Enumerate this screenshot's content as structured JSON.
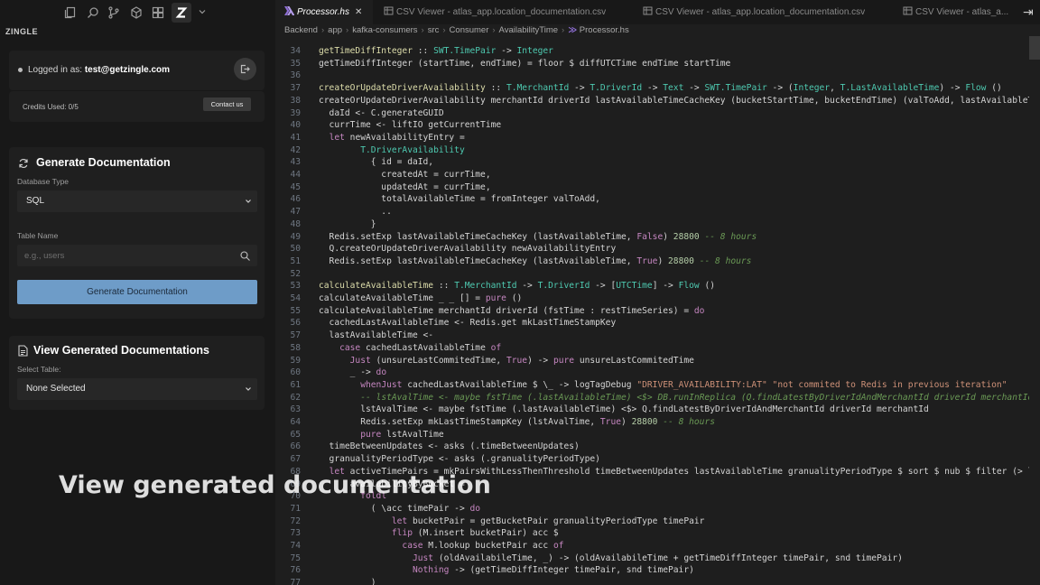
{
  "brand": "ZINGLE",
  "login": {
    "prefix": "Logged in as:",
    "email": "test@getzingle.com"
  },
  "credits": {
    "text": "Credits Used: 0/5",
    "contact_label": "Contact us"
  },
  "generate": {
    "title": "Generate Documentation",
    "db_type_label": "Database Type",
    "db_type_value": "SQL",
    "table_name_label": "Table Name",
    "table_name_placeholder": "e.g., users",
    "button_label": "Generate Documentation"
  },
  "view": {
    "title": "View Generated Documentations",
    "select_label": "Select Table:",
    "select_value": "None Selected"
  },
  "tabs": [
    {
      "label": "Processor.hs",
      "active": true
    },
    {
      "label": "CSV Viewer - atlas_app.location_documentation.csv"
    },
    {
      "label": "CSV Viewer - atlas_app.location_documentation.csv"
    },
    {
      "label": "CSV Viewer - atlas_a..."
    }
  ],
  "breadcrumb": [
    "Backend",
    "app",
    "kafka-consumers",
    "src",
    "Consumer",
    "AvailabilityTime",
    "Processor.hs"
  ],
  "code_lines": [
    {
      "n": "34",
      "t": "getTimeDiffInteger :: SWT.TimePair -> Integer"
    },
    {
      "n": "35",
      "t": "getTimeDiffInteger (startTime, endTime) = floor $ diffUTCTime endTime startTime"
    },
    {
      "n": "36",
      "t": ""
    },
    {
      "n": "37",
      "t": "createOrUpdateDriverAvailability :: T.MerchantId -> T.DriverId -> Text -> SWT.TimePair -> (Integer, T.LastAvailableTime) -> Flow ()"
    },
    {
      "n": "38",
      "t": "createOrUpdateDriverAvailability merchantId driverId lastAvailableTimeCacheKey (bucketStartTime, bucketEndTime) (valToAdd, lastAvailableTime) = do"
    },
    {
      "n": "39",
      "t": "  daId <- C.generateGUID"
    },
    {
      "n": "40",
      "t": "  currTime <- liftIO getCurrentTime"
    },
    {
      "n": "41",
      "t": "  let newAvailabilityEntry ="
    },
    {
      "n": "42",
      "t": "        T.DriverAvailability"
    },
    {
      "n": "43",
      "t": "          { id = daId,"
    },
    {
      "n": "44",
      "t": "            createdAt = currTime,"
    },
    {
      "n": "45",
      "t": "            updatedAt = currTime,"
    },
    {
      "n": "46",
      "t": "            totalAvailableTime = fromInteger valToAdd,"
    },
    {
      "n": "47",
      "t": "            .."
    },
    {
      "n": "48",
      "t": "          }"
    },
    {
      "n": "49",
      "t": "  Redis.setExp lastAvailableTimeCacheKey (lastAvailableTime, False) 28800 -- 8 hours"
    },
    {
      "n": "50",
      "t": "  Q.createOrUpdateDriverAvailability newAvailabilityEntry"
    },
    {
      "n": "51",
      "t": "  Redis.setExp lastAvailableTimeCacheKey (lastAvailableTime, True) 28800 -- 8 hours"
    },
    {
      "n": "52",
      "t": ""
    },
    {
      "n": "53",
      "t": "calculateAvailableTime :: T.MerchantId -> T.DriverId -> [UTCTime] -> Flow ()"
    },
    {
      "n": "54",
      "t": "calculateAvailableTime _ _ [] = pure ()"
    },
    {
      "n": "55",
      "t": "calculateAvailableTime merchantId driverId (fstTime : restTimeSeries) = do"
    },
    {
      "n": "56",
      "t": "  cachedLastAvailableTime <- Redis.get mkLastTimeStampKey"
    },
    {
      "n": "57",
      "t": "  lastAvailableTime <-"
    },
    {
      "n": "58",
      "t": "    case cachedLastAvailableTime of"
    },
    {
      "n": "59",
      "t": "      Just (unsureLastCommitedTime, True) -> pure unsureLastCommitedTime"
    },
    {
      "n": "60",
      "t": "      _ -> do"
    },
    {
      "n": "61",
      "t": "        whenJust cachedLastAvailableTime $ \\_ -> logTagDebug \"DRIVER_AVAILABILITY:LAT\" \"not commited to Redis in previous iteration\""
    },
    {
      "n": "62",
      "t": "        -- lstAvalTime <- maybe fstTime (.lastAvailableTime) <$> DB.runInReplica (Q.findLatestByDriverIdAndMerchantId driverId merchantId)"
    },
    {
      "n": "63",
      "t": "        lstAvalTime <- maybe fstTime (.lastAvailableTime) <$> Q.findLatestByDriverIdAndMerchantId driverId merchantId"
    },
    {
      "n": "64",
      "t": "        Redis.setExp mkLastTimeStampKey (lstAvalTime, True) 28800 -- 8 hours"
    },
    {
      "n": "65",
      "t": "        pure lstAvalTime"
    },
    {
      "n": "66",
      "t": "  timeBetweenUpdates <- asks (.timeBetweenUpdates)"
    },
    {
      "n": "67",
      "t": "  granualityPeriodType <- asks (.granualityPeriodType)"
    },
    {
      "n": "68",
      "t": "  let activeTimePairs = mkPairsWithLessThenThreshold timeBetweenUpdates lastAvailableTime granualityPeriodType $ sort $ nub $ filter (> lastAvail"
    },
    {
      "n": "69",
      "t": "      availabilityByBucket ="
    },
    {
      "n": "70",
      "t": "        foldl"
    },
    {
      "n": "71",
      "t": "          ( \\acc timePair -> do"
    },
    {
      "n": "72",
      "t": "              let bucketPair = getBucketPair granualityPeriodType timePair"
    },
    {
      "n": "73",
      "t": "              flip (M.insert bucketPair) acc $"
    },
    {
      "n": "74",
      "t": "                case M.lookup bucketPair acc of"
    },
    {
      "n": "75",
      "t": "                  Just (oldAvailabileTime, _) -> (oldAvailabileTime + getTimeDiffInteger timePair, snd timePair)"
    },
    {
      "n": "76",
      "t": "                  Nothing -> (getTimeDiffInteger timePair, snd timePair)"
    },
    {
      "n": "77",
      "t": "          )"
    }
  ],
  "overlay_caption": "View generated documentation",
  "colors": {
    "accent_button": "#6e9cc8",
    "editor_bg": "#1e1e1e",
    "panel_bg": "#181818"
  }
}
